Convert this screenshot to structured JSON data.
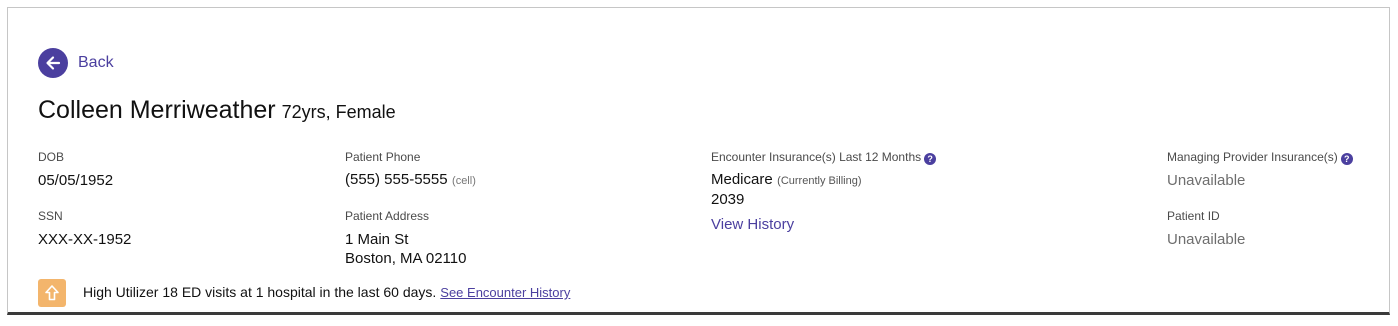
{
  "header": {
    "back_label": "Back",
    "patient_name": "Colleen Merriweather",
    "patient_meta": "72yrs, Female"
  },
  "demographics": {
    "dob_label": "DOB",
    "dob_value": "05/05/1952",
    "ssn_label": "SSN",
    "ssn_value": "XXX-XX-1952",
    "phone_label": "Patient Phone",
    "phone_value": "(555) 555-5555",
    "phone_type": "(cell)",
    "address_label": "Patient Address",
    "address_line1": "1 Main St",
    "address_line2": "Boston, MA 02110"
  },
  "encounter_insurance": {
    "label": "Encounter Insurance(s) Last 12 Months",
    "plan_name": "Medicare",
    "plan_status": "(Currently Billing)",
    "plan_number": "2039",
    "view_history_label": "View History"
  },
  "managing_provider": {
    "insurance_label": "Managing Provider Insurance(s)",
    "insurance_value": "Unavailable",
    "patient_id_label": "Patient ID",
    "patient_id_value": "Unavailable"
  },
  "alert": {
    "text": "High Utilizer 18 ED visits at 1 hospital in the last 60 days.",
    "link_label": "See Encounter History"
  },
  "colors": {
    "accent": "#4b3f9f",
    "alert_icon_bg": "#f3b56c",
    "muted_text": "#6e6e6e"
  },
  "icons": {
    "back": "arrow-left-circle-icon",
    "help": "question-circle-icon",
    "alert": "arrow-up-icon"
  }
}
